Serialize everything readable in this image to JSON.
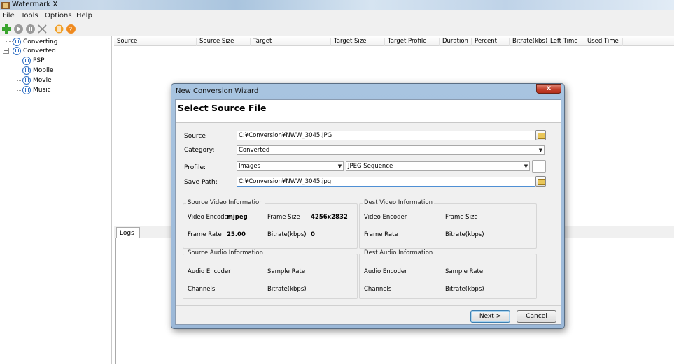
{
  "window": {
    "title": "Watermark X"
  },
  "menu": [
    "File",
    "Tools",
    "Options",
    "Help"
  ],
  "tree": {
    "converting": "Converting",
    "converted": "Converted",
    "children": [
      "PSP",
      "Mobile",
      "Movie",
      "Music"
    ]
  },
  "table": {
    "columns": [
      "Source",
      "Source Size",
      "Target",
      "Target Size",
      "Target Profile",
      "Duration",
      "Percent",
      "Bitrate(kbs)",
      "Left Time",
      "Used Time"
    ]
  },
  "logs": {
    "tab": "Logs"
  },
  "dialog": {
    "title": "New Conversion Wizard",
    "close": "x",
    "heading": "Select Source File",
    "source_label": "Source",
    "source_value": "C:¥Conversion¥NWW_3045.JPG",
    "category_label": "Category:",
    "category_value": "Converted",
    "profile_label": "Profile:",
    "profile_value": "Images",
    "profile_sub_value": "JPEG Sequence",
    "save_label": "Save Path:",
    "save_value": "C:¥Conversion¥NWW_3045.jpg",
    "source_video": {
      "title": "Source Video Information",
      "encoder_label": "Video Encoder",
      "encoder_value": "mjpeg",
      "frame_size_label": "Frame Size",
      "frame_size_value": "4256x2832",
      "frame_rate_label": "Frame Rate",
      "frame_rate_value": "25.00",
      "bitrate_label": "Bitrate(kbps)",
      "bitrate_value": "0"
    },
    "dest_video": {
      "title": "Dest Video Information",
      "encoder_label": "Video Encoder",
      "frame_size_label": "Frame Size",
      "frame_rate_label": "Frame Rate",
      "bitrate_label": "Bitrate(kbps)"
    },
    "source_audio": {
      "title": "Source Audio Information",
      "encoder_label": "Audio Encoder",
      "sample_rate_label": "Sample Rate",
      "channels_label": "Channels",
      "bitrate_label": "Bitrate(kbps)"
    },
    "dest_audio": {
      "title": "Dest Audio Information",
      "encoder_label": "Audio Encoder",
      "sample_rate_label": "Sample Rate",
      "channels_label": "Channels",
      "bitrate_label": "Bitrate(kbps)"
    },
    "next_label": "Next >",
    "cancel_label": "Cancel"
  },
  "icons": {
    "add": "plus-icon",
    "start": "play-icon",
    "pause": "pause-icon",
    "delete": "x-icon",
    "settings": "tools-icon",
    "help": "question-icon"
  },
  "colors": {
    "accent": "#2f6fc4",
    "dialog_frame": "#a8c4e0",
    "close_button": "#c4402c"
  }
}
